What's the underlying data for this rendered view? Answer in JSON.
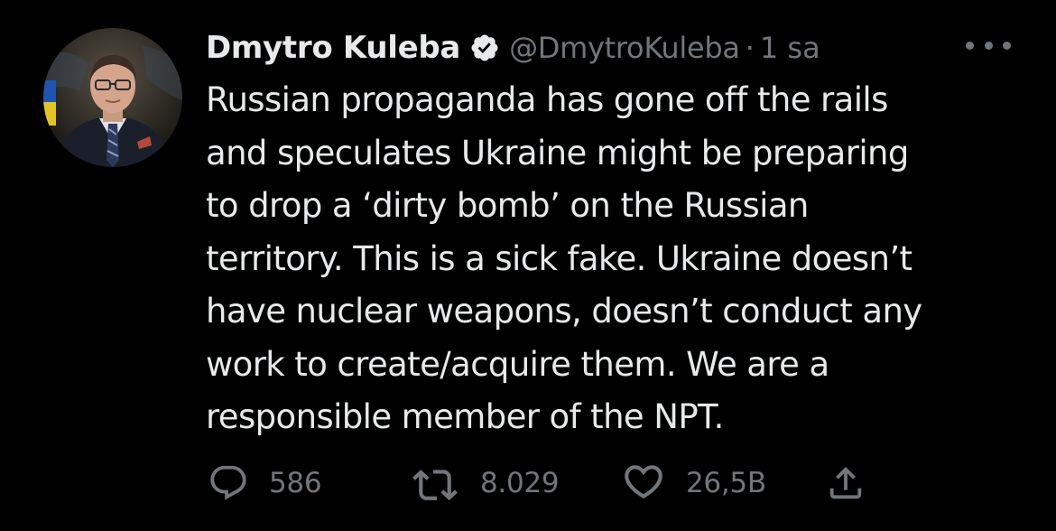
{
  "tweet": {
    "author": {
      "display_name": "Dmytro Kuleba",
      "handle": "@DmytroKuleba",
      "separator": "·",
      "time": "1 sa"
    },
    "text_lines": [
      "Russian propaganda has gone off the rails",
      "and speculates Ukraine might be preparing",
      "to drop a ‘dirty bomb’ on the Russian",
      "territory. This is a sick fake. Ukraine doesn’t",
      "have nuclear weapons, doesn’t conduct any",
      "work to create/acquire them. We are a",
      "responsible member of the NPT."
    ],
    "actions": {
      "replies": "586",
      "retweets": "8.029",
      "likes": "26,5B"
    }
  },
  "icons": {
    "verified": "verified-badge-icon",
    "more": "more-horizontal-icon",
    "reply": "reply-icon",
    "retweet": "retweet-icon",
    "like": "heart-icon",
    "share": "share-icon"
  },
  "colors": {
    "background": "#000000",
    "primary_text": "#e7e9ea",
    "secondary_text": "#71767b"
  }
}
